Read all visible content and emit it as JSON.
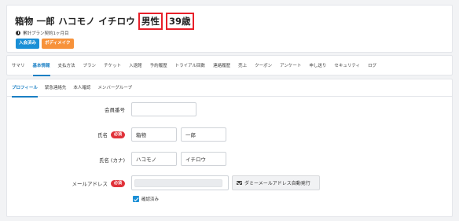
{
  "header": {
    "member_name": "箱物 一郎  ハコモノ イチロウ",
    "gender": "男性",
    "age": "39歳",
    "plan_text": "累計プラン契約1ヶ月目",
    "badges": [
      {
        "label": "入会済み",
        "color": "#1a8fd6"
      },
      {
        "label": "ボディメイク",
        "color": "#f7923a"
      }
    ],
    "highlight_color": "#e8202a"
  },
  "main_tabs": [
    {
      "label": "サマリ",
      "active": false
    },
    {
      "label": "基本情報",
      "active": true
    },
    {
      "label": "支払方法",
      "active": false
    },
    {
      "label": "プラン",
      "active": false
    },
    {
      "label": "チケット",
      "active": false
    },
    {
      "label": "入退館",
      "active": false
    },
    {
      "label": "予約履歴",
      "active": false
    },
    {
      "label": "トライアル回数",
      "active": false
    },
    {
      "label": "連絡履歴",
      "active": false
    },
    {
      "label": "売上",
      "active": false
    },
    {
      "label": "クーポン",
      "active": false
    },
    {
      "label": "アンケート",
      "active": false
    },
    {
      "label": "申し送り",
      "active": false
    },
    {
      "label": "セキュリティ",
      "active": false
    },
    {
      "label": "ログ",
      "active": false
    }
  ],
  "sub_tabs": [
    {
      "label": "プロフィール",
      "active": true
    },
    {
      "label": "緊急連絡先",
      "active": false
    },
    {
      "label": "本人確認",
      "active": false
    },
    {
      "label": "メンバーグループ",
      "active": false
    }
  ],
  "form": {
    "member_number": {
      "label": "会員番号",
      "value": ""
    },
    "name": {
      "label": "氏名",
      "required_label": "必須",
      "last": "箱物",
      "first": "一郎"
    },
    "name_kana": {
      "label": "氏名 (カナ)",
      "last": "ハコモノ",
      "first": "イチロウ"
    },
    "email": {
      "label": "メールアドレス",
      "required_label": "必須",
      "value": "",
      "dummy_button_label": "ダミーメールアドレス自動発行",
      "confirmed_label": "確認済み",
      "confirmed": true
    }
  },
  "colors": {
    "accent": "#1a7fc4",
    "required": "#e0323a",
    "background": "#f2f3f5"
  }
}
